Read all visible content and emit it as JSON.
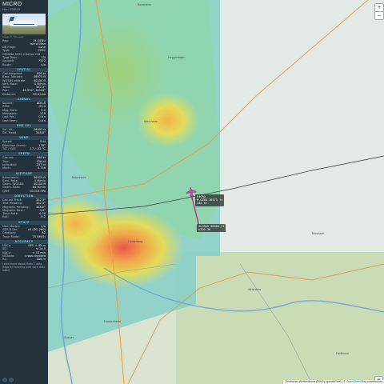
{
  "sidebar": {
    "callsign": "MICRO",
    "hex_line": "Hex: 424B18",
    "photo_caption": "Image © Tim Laue",
    "basic": [
      {
        "k": "Reg:",
        "v": "M-OZBU"
      },
      {
        "k": "",
        "v": "Isle of Man"
      },
      {
        "k": "DB Flags:",
        "v": "none"
      },
      {
        "k": "Type:",
        "v": "C25C"
      },
      {
        "k": "CESSNA 525C Citation CJ4",
        "v": ""
      },
      {
        "k": "Type Desc.:",
        "v": "L2J"
      },
      {
        "k": "Squawk:",
        "v": "7522"
      },
      {
        "k": "Route:",
        "v": "n/a"
      }
    ],
    "sections": [
      {
        "title": "SPATIAL",
        "rows": [
          {
            "k": "Groundspeed:",
            "v": "446 kt"
          },
          {
            "k": "Baro. Altitude:",
            "v": "36975 ft"
          },
          {
            "k": "WGS84 altitude:",
            "v": "40100 ft"
          },
          {
            "k": "Vert. Rate:",
            "v": "0 ft/min"
          },
          {
            "k": "Track:",
            "v": "352.3°"
          },
          {
            "k": "Pos.:",
            "v": "49.532°, 8.818°"
          },
          {
            "k": "Distance:",
            "v": "99.3 nmi"
          }
        ]
      },
      {
        "title": "SIGNAL",
        "rows": [
          {
            "k": "Source:",
            "v": "ADS-B"
          },
          {
            "k": "RSSI:",
            "v": "-23.0"
          },
          {
            "k": "Msg. Rate:",
            "v": "5.0"
          },
          {
            "k": "Messages:",
            "v": "218"
          },
          {
            "k": "Last Pos.:",
            "v": "0.6 s"
          },
          {
            "k": "Last Seen:",
            "v": "0.6 s"
          }
        ]
      },
      {
        "title": "FMS SEL",
        "rows": [
          {
            "k": "Sel. Alt.:",
            "v": "36992 ft"
          },
          {
            "k": "Sel. Head.:",
            "v": "348.8°"
          }
        ]
      },
      {
        "title": "WIND",
        "rows": [
          {
            "k": "Speed:",
            "v": "9 kt"
          },
          {
            "k": "Direction (from):",
            "v": "178°"
          },
          {
            "k": "TAT / SAT:",
            "v": "-17 / -52 °C"
          }
        ]
      },
      {
        "title": "SPEED",
        "rows": [
          {
            "k": "Ground:",
            "v": "446 kt"
          },
          {
            "k": "True:",
            "v": "436 kt"
          },
          {
            "k": "Indicated:",
            "v": "237 kt"
          },
          {
            "k": "Mach:",
            "v": "0.756"
          }
        ]
      },
      {
        "title": "ALTITUDE",
        "rows": [
          {
            "k": "Barometric:",
            "v": "36975 ft"
          },
          {
            "k": "Baro. Rate:",
            "v": "0 ft/min"
          },
          {
            "k": "Geom. WGS84:",
            "v": "40100 ft"
          },
          {
            "k": "Geom. Rate:",
            "v": "64 ft/min"
          },
          {
            "k": "QNH:",
            "v": "1013.6 hPa"
          }
        ]
      },
      {
        "title": "DIRECTION",
        "rows": [
          {
            "k": "Ground Track:",
            "v": "352.3°"
          },
          {
            "k": "True Heading:",
            "v": "352.3°"
          },
          {
            "k": "Magnetic Heading:",
            "v": "348.8°"
          },
          {
            "k": "Magnetic Decl.:",
            "v": "3.4°"
          },
          {
            "k": "Track Rate:",
            "v": "0.00"
          },
          {
            "k": "Roll:",
            "v": "-0.2"
          }
        ]
      },
      {
        "title": "STUFF",
        "rows": [
          {
            "k": "Nav. Modes:",
            "v": "n/a"
          },
          {
            "k": "ADS-B Ver.:",
            "v": "v0 (DO-260)"
          },
          {
            "k": "Category:",
            "v": "A2"
          },
          {
            "k": "Track Mode:",
            "v": "75 NM(9)"
          }
        ]
      },
      {
        "title": "ACCURACY",
        "rows": [
          {
            "k": "NACp:",
            "v": "EPU < 92 m"
          },
          {
            "k": "SIL:",
            "v": "≤ 1e-5"
          },
          {
            "k": "NACv:",
            "v": "< 10 m/s"
          },
          {
            "k": "NICbaro:",
            "v": "cross-checked"
          },
          {
            "k": "Rc:",
            "v": "186 m"
          }
        ]
      }
    ],
    "footer": "Learn more about Mode S data (tags by hovering over each data label)"
  },
  "map": {
    "attribution_prefix": "Deutscher Wetterdienst (DWD) openAIP.net | © ",
    "attribution_osm": "OpenStreetMap",
    "attribution_suffix": " contributors",
    "zoom_in": "+",
    "zoom_out": "−",
    "layers_icon": "layers-icon",
    "aircraft_label_1": "MICRO\nM-OZBU 36975 ft\n446 kt",
    "aircraft_label_2": "DLH3AX 36000 ft\nA320 36",
    "places": [
      "Bensheim",
      "Heppenheim",
      "Weinheim",
      "Mannheim",
      "Heidelberg",
      "Hockenheim",
      "Speyer",
      "Sinsheim",
      "Mosbach",
      "Heilbronn"
    ],
    "colors": {
      "accent": "#7fc4e6",
      "track": "#c0187a",
      "aircraft": "#e040c8"
    }
  }
}
